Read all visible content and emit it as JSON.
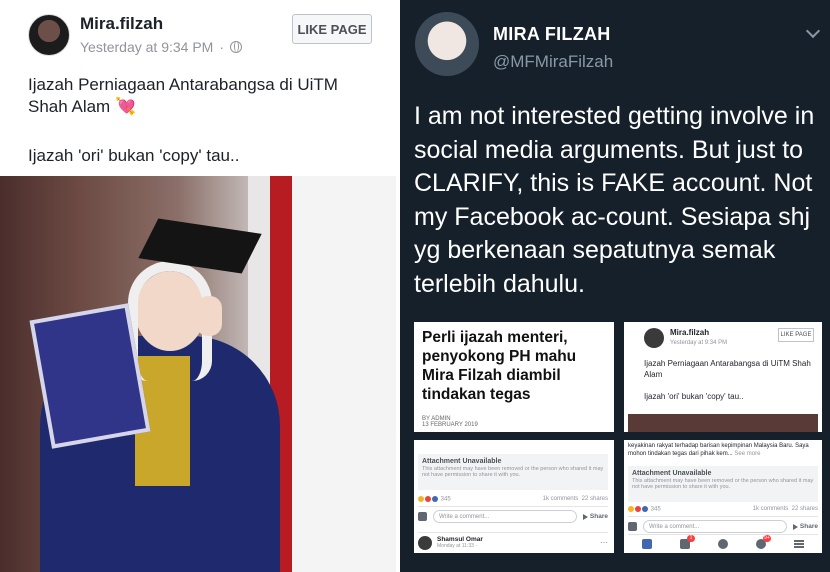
{
  "fb_post": {
    "page_name": "Mira.filzah",
    "timestamp": "Yesterday at 9:34 PM",
    "separator": "·",
    "like_page_label": "LIKE PAGE",
    "text_line1": "Ijazah Perniagaan Antarabangsa di UiTM Shah Alam",
    "heart": "💘",
    "text_line2": "Ijazah 'ori' bukan 'copy' tau.."
  },
  "tweet": {
    "name": "MIRA FILZAH",
    "handle": "@MFMiraFilzah",
    "body": "I am not interested getting involve in social media arguments. But just to CLARIFY, this is FAKE account. Not my Facebook ac-count. Sesiapa shj yg berkenaan sepatutnya semak terlebih dahulu."
  },
  "embeds": {
    "news": {
      "headline": "Perli ijazah menteri, penyokong PH mahu Mira Filzah diambil tindakan tegas",
      "byline": "BY ADMIN",
      "date": "13 FEBRUARY 2019"
    },
    "fb_copy": {
      "page_name": "Mira.filzah",
      "timestamp": "Yesterday at 9:34 PM",
      "like_page_label": "LIKE PAGE",
      "text_line1": "Ijazah Perniagaan Antarabangsa di UiTM Shah Alam",
      "text_line2": "Ijazah 'ori' bukan 'copy' tau.."
    },
    "attachment_left": {
      "title": "Attachment Unavailable",
      "desc": "This attachment may have been removed or the person who shared it may not have permission to share it with you.",
      "reactions": "345",
      "comments": "1k comments",
      "shares": "22 shares",
      "comment_placeholder": "Write a comment...",
      "share_label": "Share",
      "commenter_name": "Shamsul Omar",
      "commenter_meta": "Monday at 11:33 ·",
      "more": "···"
    },
    "attachment_right": {
      "text": "keyakinan rakyat terhadap barisan kepimpinan Malaysia Baru. Saya mohon tindakan tegas dari pihak kem...",
      "see_more": "See more",
      "title": "Attachment Unavailable",
      "desc": "This attachment may have been removed or the person who shared it may not have permission to share it with you.",
      "reactions": "345",
      "comments": "1k comments",
      "shares": "22 shares",
      "comment_placeholder": "Write a comment...",
      "share_label": "Share",
      "badges": [
        "1",
        "9+"
      ]
    }
  },
  "colors": {
    "twitter_bg": "#15202b",
    "fb_text": "#1d2129",
    "fb_meta": "#90949c",
    "tweet_handle": "#8899a6"
  }
}
